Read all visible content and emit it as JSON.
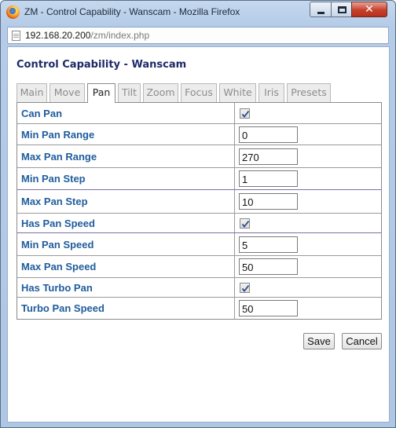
{
  "window": {
    "title": "ZM - Control Capability - Wanscam - Mozilla Firefox",
    "url_host": "192.168.20.200",
    "url_path": "/zm/index.php"
  },
  "page": {
    "title": "Control Capability - Wanscam"
  },
  "tabs": [
    {
      "label": "Main",
      "active": false
    },
    {
      "label": "Move",
      "active": false
    },
    {
      "label": "Pan",
      "active": true
    },
    {
      "label": "Tilt",
      "active": false
    },
    {
      "label": "Zoom",
      "active": false
    },
    {
      "label": "Focus",
      "active": false
    },
    {
      "label": "White",
      "active": false
    },
    {
      "label": "Iris",
      "active": false
    },
    {
      "label": "Presets",
      "active": false
    }
  ],
  "fields": [
    {
      "label": "Can Pan",
      "type": "checkbox",
      "checked": true
    },
    {
      "label": "Min Pan Range",
      "type": "text",
      "value": "0"
    },
    {
      "label": "Max Pan Range",
      "type": "text",
      "value": "270"
    },
    {
      "label": "Min Pan Step",
      "type": "text",
      "value": "1"
    },
    {
      "label": "Max Pan Step",
      "type": "text",
      "value": "10"
    },
    {
      "label": "Has Pan Speed",
      "type": "checkbox",
      "checked": true
    },
    {
      "label": "Min Pan Speed",
      "type": "text",
      "value": "5"
    },
    {
      "label": "Max Pan Speed",
      "type": "text",
      "value": "50"
    },
    {
      "label": "Has Turbo Pan",
      "type": "checkbox",
      "checked": true
    },
    {
      "label": "Turbo Pan Speed",
      "type": "text",
      "value": "50"
    }
  ],
  "buttons": {
    "save": "Save",
    "cancel": "Cancel"
  },
  "colors": {
    "label_blue": "#1f5c9c",
    "title_navy": "#1e2a66"
  }
}
